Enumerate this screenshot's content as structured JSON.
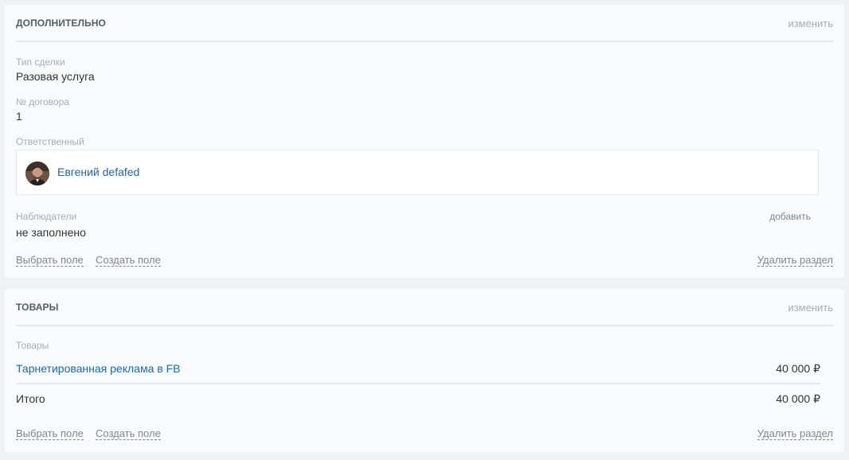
{
  "additional": {
    "title": "ДОПОЛНИТЕЛЬНО",
    "edit": "изменить",
    "deal_type_label": "Тип сделки",
    "deal_type_value": "Разовая услуга",
    "contract_label": "№ договора",
    "contract_value": "1",
    "responsible_label": "Ответственный",
    "responsible_name": "Евгений defafed",
    "observers_label": "Наблюдатели",
    "observers_add": "добавить",
    "observers_value": "не заполнено",
    "select_field": "Выбрать поле",
    "create_field": "Создать поле",
    "delete_section": "Удалить раздел"
  },
  "products": {
    "title": "ТОВАРЫ",
    "edit": "изменить",
    "label": "Товары",
    "items": [
      {
        "name": "Тарнетированная реклама в FB",
        "price": "40 000 ₽"
      }
    ],
    "total_label": "Итого",
    "total_value": "40 000 ₽",
    "select_field": "Выбрать поле",
    "create_field": "Создать поле",
    "delete_section": "Удалить раздел"
  }
}
